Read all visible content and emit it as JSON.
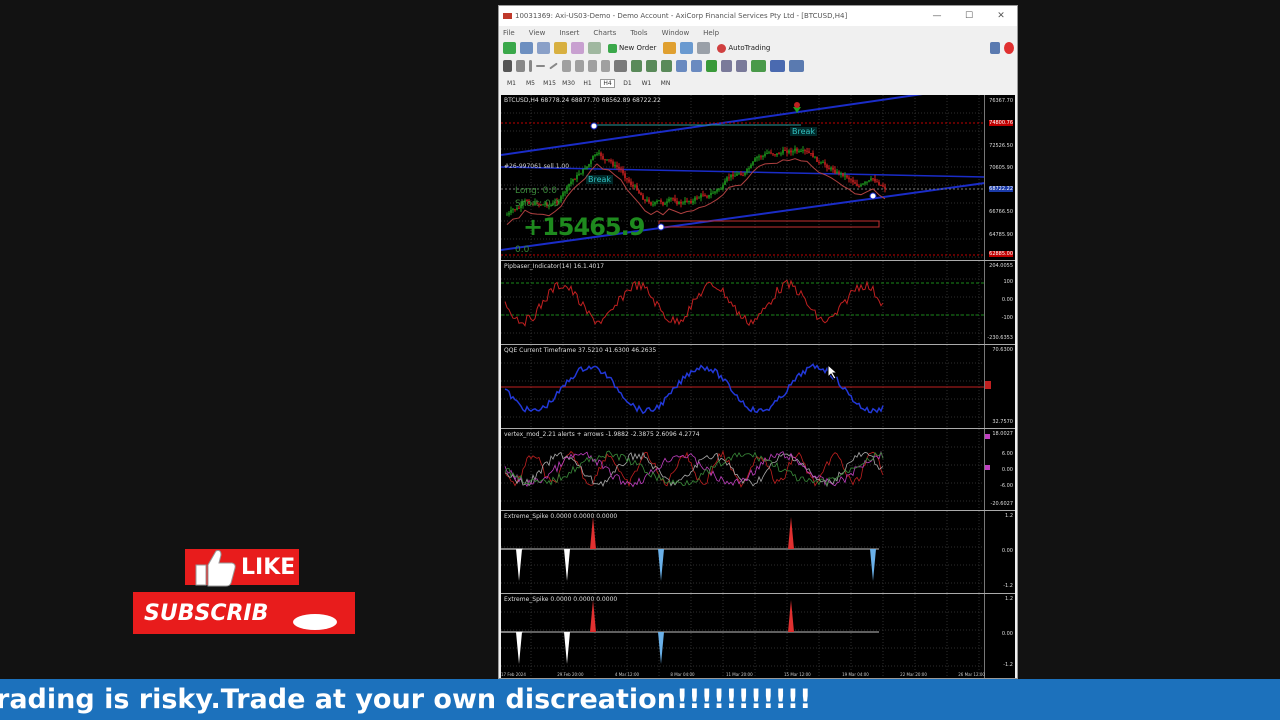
{
  "window": {
    "title": "10031369: Axi-US03-Demo - Demo Account - AxiCorp Financial Services Pty Ltd - [BTCUSD,H4]",
    "controls": {
      "minimize": "—",
      "maximize": "☐",
      "close": "✕"
    }
  },
  "menu": [
    "File",
    "View",
    "Insert",
    "Charts",
    "Tools",
    "Window",
    "Help"
  ],
  "toolbar": {
    "new_order": "New Order",
    "auto_trading": "AutoTrading"
  },
  "timeframes": [
    "M1",
    "M5",
    "M15",
    "M30",
    "H1",
    "H4",
    "D1",
    "W1",
    "MN"
  ],
  "active_timeframe": "H4",
  "main_chart": {
    "header": "BTCUSD,H4  68778.24 68877.70 68562.89 68722.22",
    "trade_label": "#26-997061 sell 1.00",
    "long_label": "Long: 0.0",
    "short_label": "Short: 0.0",
    "profit": "+15465.9",
    "zero_label": "0.0",
    "break_label": "Break",
    "price_axis": [
      "76367.70",
      "74800.76",
      "72526.50",
      "70605.90",
      "68722.22",
      "66766.50",
      "64785.90",
      "62885.00"
    ],
    "highlight_prices": {
      "74800.76": "#c00000",
      "68722.22": "#1a3aa8",
      "62885.00": "#c00000"
    }
  },
  "indicators": [
    {
      "label": "Pipbaser_Indicator(14)  16.1.4017",
      "axis": [
        "204.0055",
        "100",
        "0.00",
        "-100",
        "-230.6353"
      ]
    },
    {
      "label": "QQE Current Timeframe  37.5210  41.6300  46.2635",
      "axis": [
        "70.6300",
        "",
        "32.7570"
      ]
    },
    {
      "label": "vertex_mod_2.21 alerts + arrows  -1.9882  -2.3875  2.6096  4.2774",
      "axis": [
        "18.0027",
        "6.00",
        "0.00",
        "-6.00",
        "-20.6027"
      ]
    },
    {
      "label": "Extreme_Spike  0.0000  0.0000  0.0000",
      "axis": [
        "1.2",
        "0.00",
        "-1.2"
      ]
    },
    {
      "label": "Extreme_Spike  0.0000  0.0000  0.0000",
      "axis": [
        "1.2",
        "0.00",
        "-1.2"
      ]
    }
  ],
  "time_axis": [
    "17 Feb 2024",
    "29 Feb 20:00",
    "4 Mar 12:00",
    "8 Mar 04:00",
    "11 Mar 20:00",
    "15 Mar 12:00",
    "19 Mar 04:00",
    "22 Mar 20:00",
    "26 Mar 12:00"
  ],
  "overlay": {
    "like": "LIKE",
    "subscribe": "SUBSCRIB"
  },
  "ticker_text": "rading is risky.Trade at your own discreation!!!!!!!!!!!",
  "colors": {
    "accent_red": "#e81c1c",
    "ticker_blue": "#1c71bc",
    "bull": "#1e9e1e",
    "bear": "#d02020",
    "trend": "#1a2cc8"
  }
}
